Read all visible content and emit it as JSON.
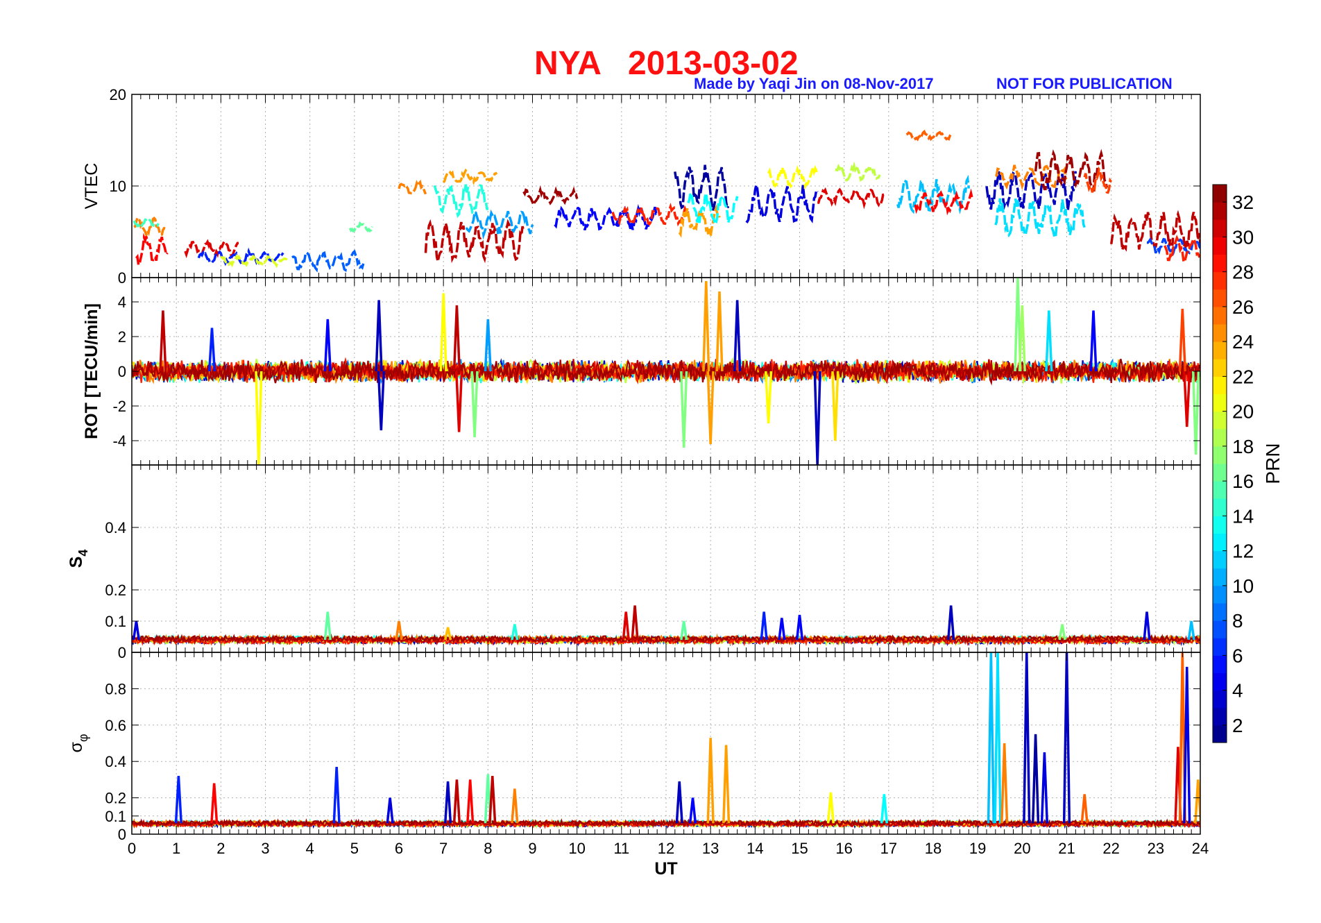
{
  "figure": {
    "title_station": "NYA",
    "title_date": "2013-03-02",
    "credit": "Made by Yaqi Jin on 08-Nov-2017",
    "notice": "NOT FOR PUBLICATION"
  },
  "chart_data": [
    {
      "type": "line",
      "panel": "vtec",
      "ylabel": "VTEC",
      "xlim": [
        0,
        24
      ],
      "ylim": [
        0,
        20
      ],
      "yticks": [
        0,
        10,
        20
      ],
      "grid": true,
      "description_of_series": "one trace per PRN satellite, colored by PRN",
      "segments": [
        {
          "prn": 25,
          "x0": 0.05,
          "x1": 0.75,
          "base": 5.5,
          "amp": 1.2
        },
        {
          "prn": 29,
          "x0": 0.1,
          "x1": 0.8,
          "base": 3.0,
          "amp": 2.0
        },
        {
          "prn": 15,
          "x0": 0.05,
          "x1": 0.6,
          "base": 6.0,
          "amp": 0.6
        },
        {
          "prn": 30,
          "x0": 1.2,
          "x1": 2.4,
          "base": 3.2,
          "amp": 1.0
        },
        {
          "prn": 6,
          "x0": 1.5,
          "x1": 3.4,
          "base": 2.2,
          "amp": 0.8
        },
        {
          "prn": 20,
          "x0": 2.0,
          "x1": 3.5,
          "base": 1.8,
          "amp": 0.6
        },
        {
          "prn": 8,
          "x0": 3.6,
          "x1": 5.2,
          "base": 1.8,
          "amp": 1.2
        },
        {
          "prn": 16,
          "x0": 4.9,
          "x1": 5.4,
          "base": 5.5,
          "amp": 0.5
        },
        {
          "prn": 25,
          "x0": 6.0,
          "x1": 6.6,
          "base": 9.8,
          "amp": 0.8
        },
        {
          "prn": 24,
          "x0": 7.0,
          "x1": 8.2,
          "base": 11.0,
          "amp": 0.8
        },
        {
          "prn": 14,
          "x0": 6.8,
          "x1": 8.0,
          "base": 8.5,
          "amp": 2.0
        },
        {
          "prn": 31,
          "x0": 6.6,
          "x1": 8.8,
          "base": 4.0,
          "amp": 2.5
        },
        {
          "prn": 10,
          "x0": 7.5,
          "x1": 9.0,
          "base": 6.0,
          "amp": 1.5
        },
        {
          "prn": 32,
          "x0": 8.8,
          "x1": 10.0,
          "base": 8.8,
          "amp": 1.0
        },
        {
          "prn": 5,
          "x0": 9.5,
          "x1": 11.8,
          "base": 6.5,
          "amp": 1.5
        },
        {
          "prn": 28,
          "x0": 10.8,
          "x1": 12.5,
          "base": 6.8,
          "amp": 1.2
        },
        {
          "prn": 2,
          "x0": 12.2,
          "x1": 13.4,
          "base": 10.0,
          "amp": 3.0
        },
        {
          "prn": 24,
          "x0": 12.3,
          "x1": 13.2,
          "base": 6.0,
          "amp": 2.0
        },
        {
          "prn": 13,
          "x0": 12.5,
          "x1": 13.6,
          "base": 7.5,
          "amp": 2.0
        },
        {
          "prn": 4,
          "x0": 13.8,
          "x1": 15.4,
          "base": 8.0,
          "amp": 2.5
        },
        {
          "prn": 21,
          "x0": 14.3,
          "x1": 15.4,
          "base": 11.0,
          "amp": 1.2
        },
        {
          "prn": 30,
          "x0": 15.4,
          "x1": 16.9,
          "base": 8.8,
          "amp": 1.0
        },
        {
          "prn": 19,
          "x0": 15.8,
          "x1": 16.8,
          "base": 11.5,
          "amp": 1.0
        },
        {
          "prn": 26,
          "x0": 17.4,
          "x1": 18.4,
          "base": 15.5,
          "amp": 0.5
        },
        {
          "prn": 11,
          "x0": 17.2,
          "x1": 18.8,
          "base": 9.0,
          "amp": 2.0
        },
        {
          "prn": 29,
          "x0": 17.6,
          "x1": 18.9,
          "base": 8.2,
          "amp": 1.2
        },
        {
          "prn": 3,
          "x0": 19.2,
          "x1": 21.2,
          "base": 9.5,
          "amp": 2.5
        },
        {
          "prn": 25,
          "x0": 19.4,
          "x1": 21.0,
          "base": 11.0,
          "amp": 1.5
        },
        {
          "prn": 12,
          "x0": 19.4,
          "x1": 21.4,
          "base": 6.5,
          "amp": 2.5
        },
        {
          "prn": 32,
          "x0": 20.3,
          "x1": 21.9,
          "base": 11.5,
          "amp": 2.5
        },
        {
          "prn": 27,
          "x0": 21.4,
          "x1": 22.0,
          "base": 10.5,
          "amp": 1.5
        },
        {
          "prn": 31,
          "x0": 22.0,
          "x1": 24.0,
          "base": 5.0,
          "amp": 2.5
        },
        {
          "prn": 7,
          "x0": 22.8,
          "x1": 24.0,
          "base": 3.5,
          "amp": 1.0
        },
        {
          "prn": 28,
          "x0": 23.2,
          "x1": 24.0,
          "base": 3.0,
          "amp": 1.5
        }
      ]
    },
    {
      "type": "line",
      "panel": "rot",
      "ylabel": "ROT [TECU/min]",
      "xlim": [
        0,
        24
      ],
      "ylim": [
        -5.4,
        5.4
      ],
      "yticks": [
        -4,
        -2,
        0,
        2,
        4
      ],
      "grid": true,
      "noise_level": 0.45,
      "spikes": [
        {
          "x": 0.7,
          "y": 3.5,
          "prn": 31
        },
        {
          "x": 1.8,
          "y": 2.5,
          "prn": 6
        },
        {
          "x": 2.85,
          "y": -5.4,
          "prn": 21
        },
        {
          "x": 4.4,
          "y": 3.0,
          "prn": 5
        },
        {
          "x": 5.55,
          "y": 4.1,
          "prn": 3
        },
        {
          "x": 5.6,
          "y": -3.4,
          "prn": 3
        },
        {
          "x": 7.0,
          "y": 4.5,
          "prn": 21
        },
        {
          "x": 7.3,
          "y": 3.8,
          "prn": 31
        },
        {
          "x": 7.35,
          "y": -3.5,
          "prn": 30
        },
        {
          "x": 7.7,
          "y": -3.8,
          "prn": 17
        },
        {
          "x": 8.0,
          "y": 3.0,
          "prn": 10
        },
        {
          "x": 12.9,
          "y": 5.2,
          "prn": 24
        },
        {
          "x": 13.0,
          "y": -4.2,
          "prn": 24
        },
        {
          "x": 13.2,
          "y": 4.6,
          "prn": 24
        },
        {
          "x": 13.6,
          "y": 4.1,
          "prn": 3
        },
        {
          "x": 12.4,
          "y": -4.4,
          "prn": 17
        },
        {
          "x": 15.4,
          "y": -5.4,
          "prn": 3
        },
        {
          "x": 15.8,
          "y": -4.0,
          "prn": 22
        },
        {
          "x": 14.3,
          "y": -3.0,
          "prn": 21
        },
        {
          "x": 19.9,
          "y": 5.4,
          "prn": 17
        },
        {
          "x": 20.0,
          "y": 3.8,
          "prn": 18
        },
        {
          "x": 20.6,
          "y": 3.5,
          "prn": 12
        },
        {
          "x": 21.6,
          "y": 3.5,
          "prn": 5
        },
        {
          "x": 23.6,
          "y": 3.6,
          "prn": 27
        },
        {
          "x": 23.9,
          "y": -4.8,
          "prn": 17
        },
        {
          "x": 23.7,
          "y": -3.2,
          "prn": 30
        }
      ]
    },
    {
      "type": "line",
      "panel": "s4",
      "ylabel": "S4",
      "xlim": [
        0,
        24
      ],
      "ylim": [
        0,
        0.6
      ],
      "yticks": [
        0,
        0.1,
        0.2,
        0.4
      ],
      "grid": true,
      "baseline": 0.04,
      "spikes": [
        {
          "x": 0.1,
          "y": 0.1,
          "prn": 4
        },
        {
          "x": 4.4,
          "y": 0.13,
          "prn": 16
        },
        {
          "x": 6.0,
          "y": 0.1,
          "prn": 25
        },
        {
          "x": 7.1,
          "y": 0.08,
          "prn": 23
        },
        {
          "x": 8.6,
          "y": 0.09,
          "prn": 14
        },
        {
          "x": 11.1,
          "y": 0.13,
          "prn": 30
        },
        {
          "x": 11.3,
          "y": 0.15,
          "prn": 31
        },
        {
          "x": 12.4,
          "y": 0.1,
          "prn": 16
        },
        {
          "x": 14.2,
          "y": 0.13,
          "prn": 6
        },
        {
          "x": 14.6,
          "y": 0.11,
          "prn": 5
        },
        {
          "x": 15.0,
          "y": 0.12,
          "prn": 5
        },
        {
          "x": 18.4,
          "y": 0.15,
          "prn": 3
        },
        {
          "x": 20.9,
          "y": 0.09,
          "prn": 17
        },
        {
          "x": 22.8,
          "y": 0.13,
          "prn": 4
        },
        {
          "x": 23.8,
          "y": 0.1,
          "prn": 11
        }
      ]
    },
    {
      "type": "line",
      "panel": "sigma_phi",
      "ylabel": "σφ",
      "xlim": [
        0,
        24
      ],
      "xticks": [
        0,
        1,
        2,
        3,
        4,
        5,
        6,
        7,
        8,
        9,
        10,
        11,
        12,
        13,
        14,
        15,
        16,
        17,
        18,
        19,
        20,
        21,
        22,
        23,
        24
      ],
      "xlabel": "UT",
      "ylim": [
        0,
        1
      ],
      "yticks": [
        0,
        0.1,
        0.2,
        0.4,
        0.6,
        0.8
      ],
      "grid": true,
      "baseline": 0.06,
      "spikes": [
        {
          "x": 1.05,
          "y": 0.32,
          "prn": 6
        },
        {
          "x": 1.85,
          "y": 0.28,
          "prn": 29
        },
        {
          "x": 4.6,
          "y": 0.37,
          "prn": 6
        },
        {
          "x": 5.8,
          "y": 0.2,
          "prn": 4
        },
        {
          "x": 7.1,
          "y": 0.29,
          "prn": 3
        },
        {
          "x": 7.3,
          "y": 0.3,
          "prn": 31
        },
        {
          "x": 7.6,
          "y": 0.3,
          "prn": 29
        },
        {
          "x": 8.0,
          "y": 0.33,
          "prn": 16
        },
        {
          "x": 8.1,
          "y": 0.32,
          "prn": 31
        },
        {
          "x": 8.6,
          "y": 0.25,
          "prn": 25
        },
        {
          "x": 12.3,
          "y": 0.29,
          "prn": 3
        },
        {
          "x": 12.6,
          "y": 0.2,
          "prn": 5
        },
        {
          "x": 13.0,
          "y": 0.53,
          "prn": 24
        },
        {
          "x": 13.35,
          "y": 0.49,
          "prn": 24
        },
        {
          "x": 15.7,
          "y": 0.23,
          "prn": 21
        },
        {
          "x": 16.9,
          "y": 0.22,
          "prn": 13
        },
        {
          "x": 19.3,
          "y": 1.0,
          "prn": 11
        },
        {
          "x": 19.45,
          "y": 1.0,
          "prn": 12
        },
        {
          "x": 19.6,
          "y": 0.5,
          "prn": 25
        },
        {
          "x": 20.1,
          "y": 1.0,
          "prn": 3
        },
        {
          "x": 20.3,
          "y": 0.55,
          "prn": 2
        },
        {
          "x": 20.5,
          "y": 0.45,
          "prn": 4
        },
        {
          "x": 21.0,
          "y": 1.0,
          "prn": 3
        },
        {
          "x": 21.4,
          "y": 0.22,
          "prn": 26
        },
        {
          "x": 23.5,
          "y": 0.48,
          "prn": 30
        },
        {
          "x": 23.6,
          "y": 1.0,
          "prn": 26
        },
        {
          "x": 23.7,
          "y": 0.92,
          "prn": 4
        },
        {
          "x": 23.95,
          "y": 0.3,
          "prn": 24
        }
      ]
    }
  ],
  "colorbar": {
    "label": "PRN",
    "range": [
      1,
      33
    ],
    "ticks": [
      2,
      4,
      6,
      8,
      10,
      12,
      14,
      16,
      18,
      20,
      22,
      24,
      26,
      28,
      30,
      32
    ],
    "colormap": "jet",
    "colors": [
      "#000090",
      "#0000c8",
      "#0010ff",
      "#0050ff",
      "#0090ff",
      "#00d0ff",
      "#20ffdf",
      "#60ff9f",
      "#a0ff60",
      "#dfff20",
      "#ffe000",
      "#ffa000",
      "#ff6000",
      "#ff2000",
      "#e00000",
      "#a00000",
      "#800000"
    ]
  }
}
